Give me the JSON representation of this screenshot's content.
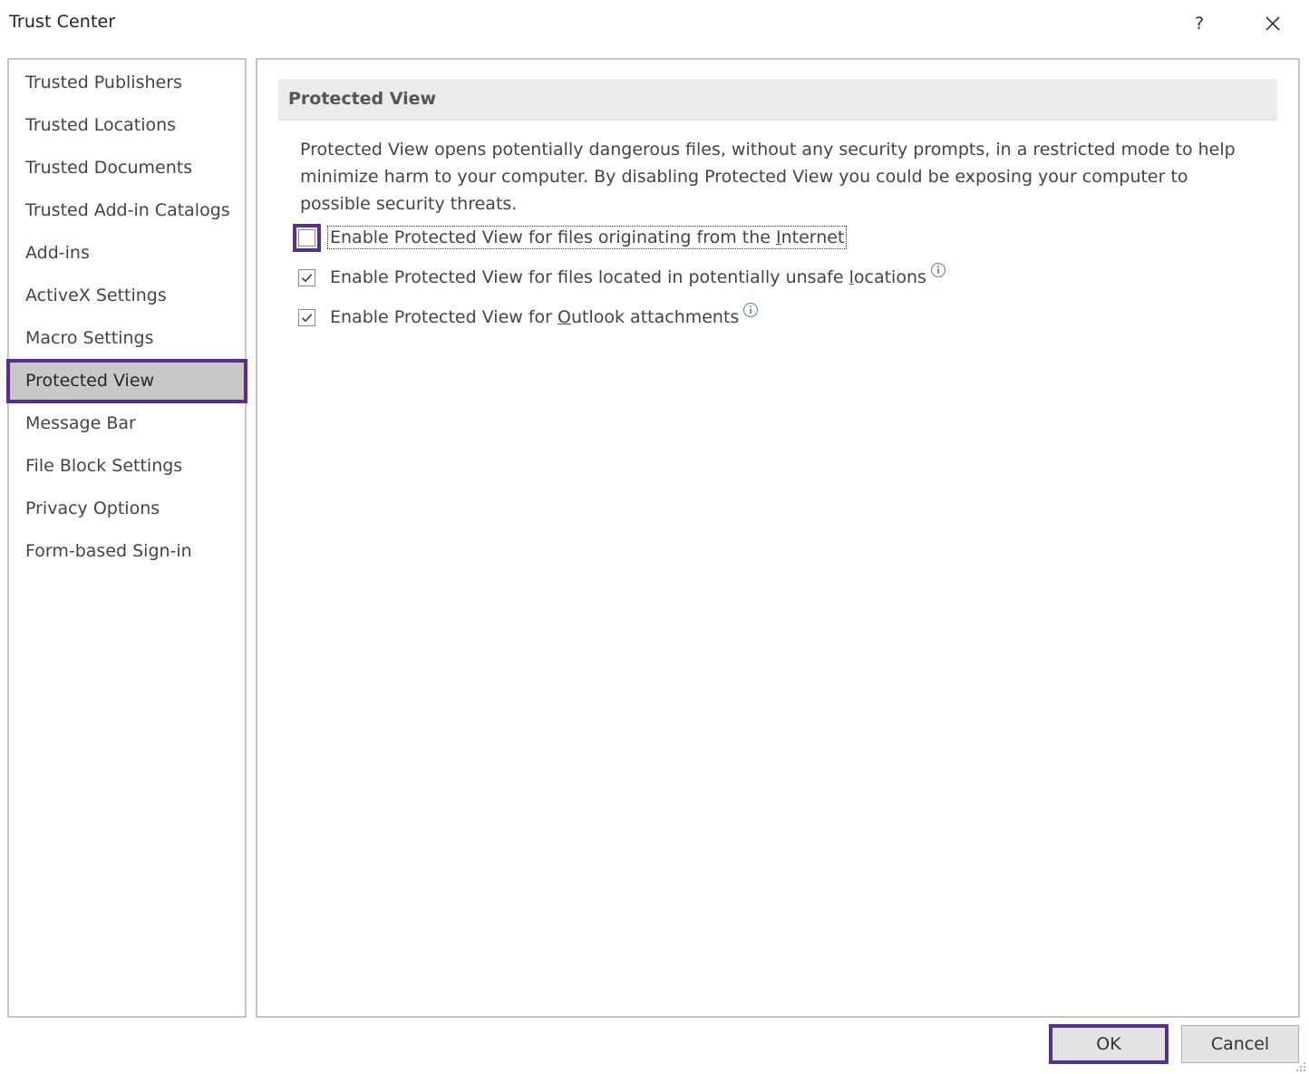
{
  "window": {
    "title": "Trust Center",
    "help_label": "?",
    "close_icon": "close-icon"
  },
  "sidebar": {
    "items": [
      {
        "label": "Trusted Publishers",
        "selected": false
      },
      {
        "label": "Trusted Locations",
        "selected": false
      },
      {
        "label": "Trusted Documents",
        "selected": false
      },
      {
        "label": "Trusted Add-in Catalogs",
        "selected": false
      },
      {
        "label": "Add-ins",
        "selected": false
      },
      {
        "label": "ActiveX Settings",
        "selected": false
      },
      {
        "label": "Macro Settings",
        "selected": false
      },
      {
        "label": "Protected View",
        "selected": true
      },
      {
        "label": "Message Bar",
        "selected": false
      },
      {
        "label": "File Block Settings",
        "selected": false
      },
      {
        "label": "Privacy Options",
        "selected": false
      },
      {
        "label": "Form-based Sign-in",
        "selected": false
      }
    ]
  },
  "main": {
    "section_title": "Protected View",
    "description": "Protected View opens potentially dangerous files, without any security prompts, in a restricted mode to help minimize harm to your computer. By disabling Protected View you could be exposing your computer to possible security threats.",
    "options": [
      {
        "label_before": "Enable Protected View for files originating from the ",
        "mnemonic": "I",
        "label_after": "nternet",
        "checked": false,
        "info": false
      },
      {
        "label_before": "Enable Protected View for files located in potentially unsafe ",
        "mnemonic": "l",
        "label_after": "ocations",
        "checked": true,
        "info": true
      },
      {
        "label_before": "Enable Protected View for ",
        "mnemonic": "O",
        "label_after": "utlook attachments",
        "checked": true,
        "info": true
      }
    ]
  },
  "footer": {
    "ok_label": "OK",
    "cancel_label": "Cancel"
  },
  "colors": {
    "focus_accent": "#5a2d91",
    "selected_background": "#c8c8c8",
    "header_background": "#ebebeb",
    "border": "#c6c6c6",
    "info_icon": "#6b8fc7"
  }
}
